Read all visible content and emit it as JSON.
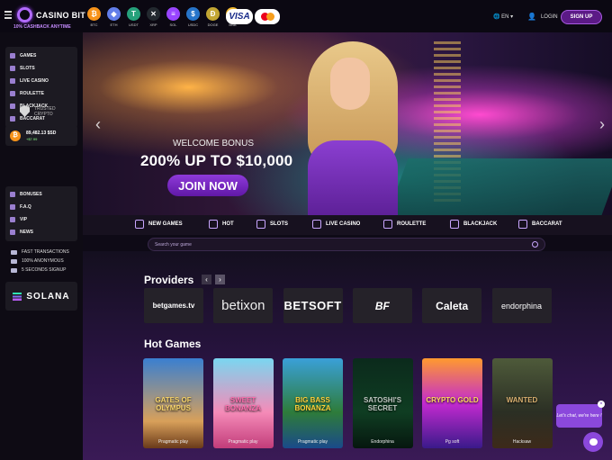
{
  "brand": {
    "name": "CASINO BIT",
    "tagline": "10% CASHBACK ANYTIME"
  },
  "coins": [
    {
      "symbol": "₿",
      "label": "BTC",
      "color": "#f7931a"
    },
    {
      "symbol": "◆",
      "label": "ETH",
      "color": "#627eea"
    },
    {
      "symbol": "T",
      "label": "USDT",
      "color": "#26a17b"
    },
    {
      "symbol": "✕",
      "label": "XRP",
      "color": "#23292f"
    },
    {
      "symbol": "≡",
      "label": "SOL",
      "color": "#9945ff"
    },
    {
      "symbol": "$",
      "label": "USDC",
      "color": "#2775ca"
    },
    {
      "symbol": "Ð",
      "label": "DOGE",
      "color": "#c2a633"
    },
    {
      "symbol": "◇",
      "label": "BNB",
      "color": "#f3ba2f"
    }
  ],
  "payments": {
    "visa": "VISA"
  },
  "header": {
    "lang": "EN",
    "login": "LOGIN",
    "signup": "SIGN UP"
  },
  "sidebar": {
    "games": [
      "GAMES",
      "SLOTS",
      "LIVE CASINO",
      "ROULETTE",
      "BLACKJACK",
      "BACCARAT"
    ],
    "trusted": [
      "TRUSTED",
      "CRYPTO"
    ],
    "balance": {
      "value": "89,482.13 $SD",
      "sub": "+$7.99"
    },
    "links": [
      "BONUSES",
      "F.A.Q",
      "VIP",
      "NEWS"
    ],
    "features": [
      "FAST TRANSACTIONS",
      "100% ANONYMOUS",
      "5 SECONDS SIGNUP"
    ],
    "solana": "SOLANA"
  },
  "hero": {
    "welcome": "WELCOME BONUS",
    "headline": "200% UP TO $10,000",
    "cta": "JOIN NOW"
  },
  "categories": [
    "NEW GAMES",
    "HOT",
    "SLOTS",
    "LIVE CASINO",
    "ROULETTE",
    "BLACKJACK",
    "BACCARAT"
  ],
  "search": {
    "placeholder": "Search your game"
  },
  "providers": {
    "title": "Providers",
    "items": [
      "betgames.tv",
      "betixon",
      "BETSOFT",
      "BF",
      "Caleta",
      "endorphina"
    ]
  },
  "hot_games": {
    "title": "Hot Games",
    "items": [
      {
        "name": "GATES OF OLYMPUS",
        "provider": "Pragmatic play",
        "bg": "linear-gradient(#3a7fd0,#d8a05a 70%,#6a3a1a)"
      },
      {
        "name": "SWEET BONANZA",
        "provider": "Pragmatic play",
        "bg": "linear-gradient(#7ad6f0,#f58bb8 60%,#c23c7a)"
      },
      {
        "name": "BIG BASS BONANZA",
        "provider": "Pragmatic play",
        "bg": "linear-gradient(#3aa0d8,#2e7c3a 60%,#1a4a8a)"
      },
      {
        "name": "SATOSHI'S SECRET",
        "provider": "Endorphina",
        "bg": "linear-gradient(#0b2a1c,#0f3d22 60%,#06170f)"
      },
      {
        "name": "CRYPTO GOLD",
        "provider": "Pg soft",
        "bg": "linear-gradient(#ff9a2e,#c32ad0 50%,#3a1a8a)"
      },
      {
        "name": "WANTED",
        "provider": "Hacksaw",
        "bg": "linear-gradient(#4e5a3a,#2b2f24 60%,#3d2a1a)"
      }
    ]
  },
  "chat": {
    "bubble": "Let's chat, we're here !",
    "close": "×"
  }
}
